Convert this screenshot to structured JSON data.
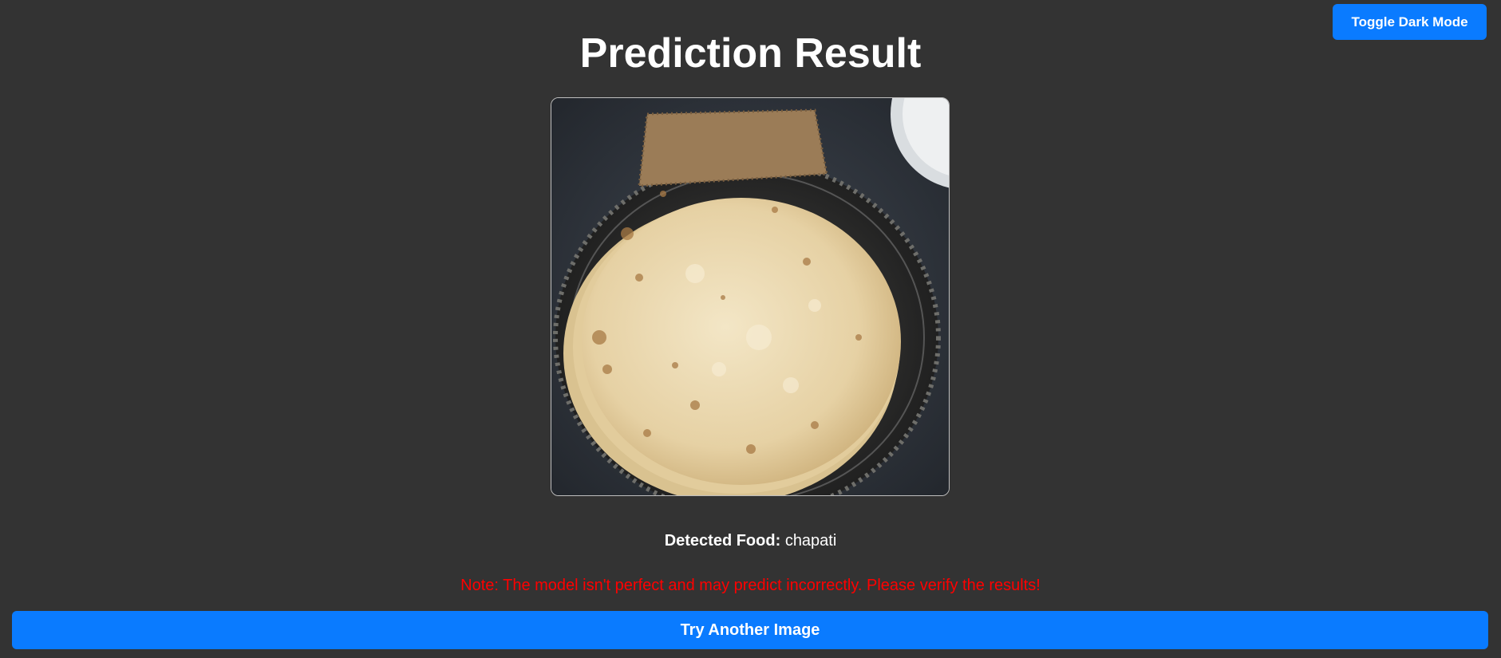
{
  "header": {
    "toggle_label": "Toggle Dark Mode",
    "title": "Prediction Result"
  },
  "result": {
    "label": "Detected Food:",
    "value": "chapati"
  },
  "note": "Note: The model isn't perfect and may predict incorrectly. Please verify the results!",
  "actions": {
    "try_again_label": "Try Another Image"
  },
  "colors": {
    "background": "#333333",
    "accent": "#0a7bff",
    "note": "#ff0000"
  }
}
